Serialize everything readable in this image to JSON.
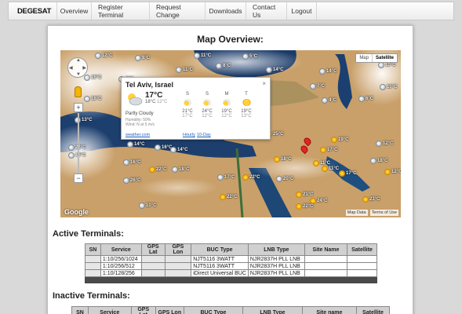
{
  "brand": {
    "name": "DEGESAT"
  },
  "nav": [
    "Overview",
    "Register Terminal",
    "Request Change",
    "Downloads",
    "Contact Us",
    "Logout"
  ],
  "map": {
    "title": "Map Overview:",
    "type_controls": {
      "map": "Map",
      "satellite": "Satellite"
    },
    "google": "Google",
    "footer": {
      "data": "Map Data",
      "terms": "Terms of Use"
    },
    "zoom_in": "+",
    "zoom_out": "−",
    "cities": [
      "12°C",
      "8°C",
      "11°C",
      "5°C",
      "16°C",
      "8°C",
      "11°C",
      "8°C",
      "14°C",
      "14°C",
      "10°C",
      "18°C",
      "13°C",
      "8°C",
      "7°C",
      "12°C",
      "7°C",
      "4°C",
      "6°C",
      "10°C",
      "22°C",
      "16°C",
      "16°C",
      "14°C",
      "14°C",
      "16°C",
      "18°C",
      "11°C",
      "11°C",
      "12°C",
      "25°C",
      "17°C",
      "18°C",
      "22°C",
      "17°C",
      "22°C",
      "20°C",
      "17°C",
      "22°C",
      "21°C",
      "24°C",
      "22°C",
      "23°C",
      "26°C",
      "10°C",
      "12°C",
      "19°C",
      "18°C"
    ],
    "info": {
      "title": "Tel Aviv, Israel",
      "close": "×",
      "temp": "17°C",
      "hi": "18°C",
      "lo": "12°C",
      "condition": "Partly Cloudy",
      "humidity": "Humidity: 59%",
      "wind": "Wind: N at 5 m/s",
      "forecast": [
        {
          "day": "S",
          "hi": "21°C",
          "lo": "17°C"
        },
        {
          "day": "S",
          "hi": "24°C",
          "lo": "12°C"
        },
        {
          "day": "M",
          "hi": "19°C",
          "lo": "12°C"
        },
        {
          "day": "T",
          "hi": "19°C",
          "lo": "13°C"
        }
      ],
      "links": {
        "source": "weather.com",
        "hourly": "Hourly",
        "tenday": "10-Day"
      }
    }
  },
  "active": {
    "title": "Active Terminals:",
    "headers": [
      "SN",
      "Service",
      "GPS Lat",
      "GPS Lon",
      "BUC Type",
      "LNB Type",
      "Site Name",
      "Satellite"
    ],
    "rows": [
      [
        "",
        "1:10/256/1024",
        "",
        "",
        "NJT5116 3WATT",
        "NJR2837H PLL LNB",
        "",
        ""
      ],
      [
        "",
        "1:10/256/512",
        "",
        "",
        "NJT5116 3WATT",
        "NJR2837H PLL LNB",
        "",
        ""
      ],
      [
        "",
        "1:10/128/256",
        "",
        "",
        "iDirect Universal BUC",
        "NJR2837H PLL LNB",
        "",
        ""
      ]
    ]
  },
  "inactive": {
    "title": "Inactive Terminals:",
    "headers": [
      "SN",
      "Service",
      "GPS Lat",
      "GPS Lon",
      "BUC Type",
      "LNB Type",
      "Site name",
      "Satellite"
    ]
  },
  "colors": {
    "nav_bg": "#f2f2f2",
    "pin": "#e52520",
    "table_header": "#d0d0d0",
    "table_footer": "#4a4a4a"
  }
}
